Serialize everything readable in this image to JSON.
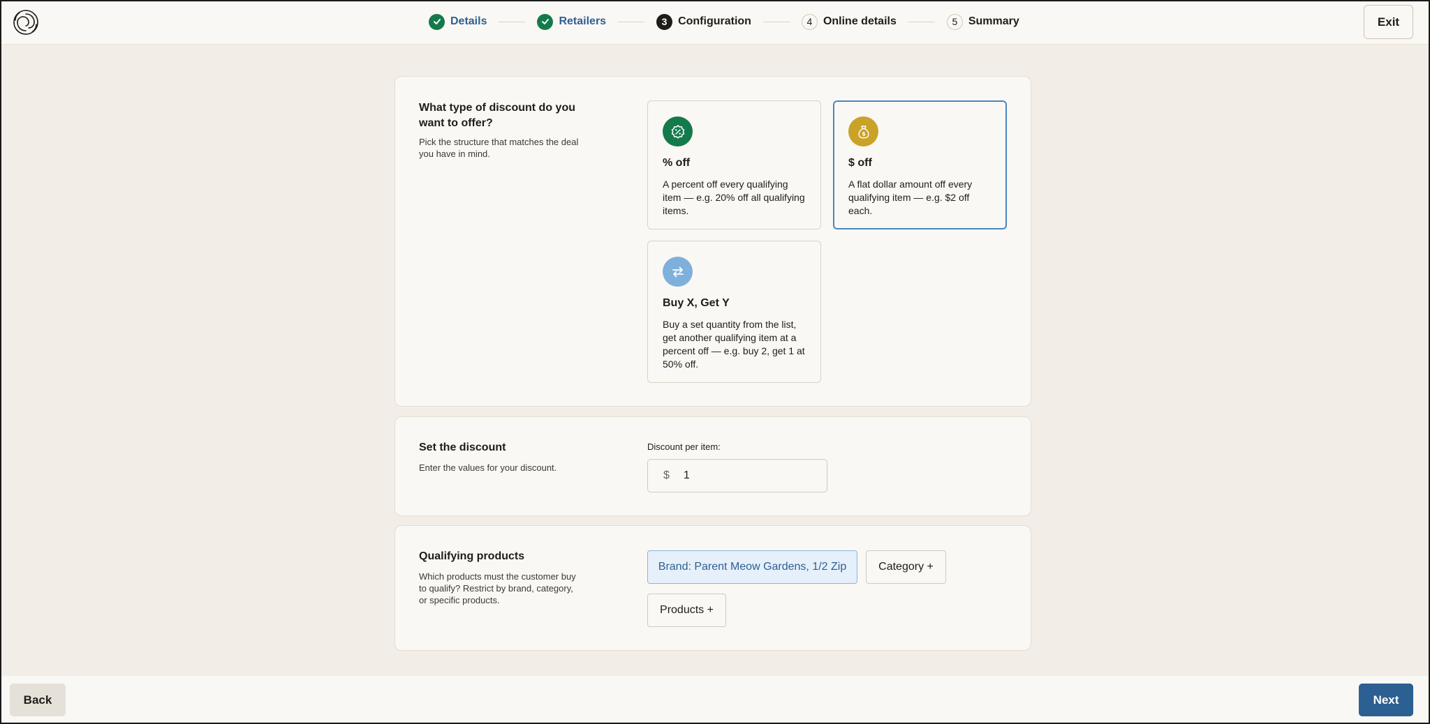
{
  "header": {
    "exit_label": "Exit",
    "steps": [
      {
        "number": "1",
        "label": "Details",
        "state": "done"
      },
      {
        "number": "2",
        "label": "Retailers",
        "state": "done"
      },
      {
        "number": "3",
        "label": "Configuration",
        "state": "current"
      },
      {
        "number": "4",
        "label": "Online details",
        "state": "todo"
      },
      {
        "number": "5",
        "label": "Summary",
        "state": "todo"
      }
    ]
  },
  "discount_type": {
    "title": "What type of discount do you want to offer?",
    "description": "Pick the structure that matches the deal you have in mind.",
    "options": [
      {
        "icon": "percent-badge-icon",
        "icon_color": "#147a4c",
        "title": "% off",
        "description": "A percent off every qualifying item — e.g. 20% off all qualifying items.",
        "selected": false
      },
      {
        "icon": "money-bag-icon",
        "icon_color": "#c9a227",
        "title": "$ off",
        "description": "A flat dollar amount off every qualifying item — e.g. $2 off each.",
        "selected": true
      },
      {
        "icon": "swap-arrows-icon",
        "icon_color": "#7fb0dc",
        "title": "Buy X, Get Y",
        "description": "Buy a set quantity from the list, get another qualifying item at a percent off — e.g. buy 2, get 1 at 50% off.",
        "selected": false
      }
    ]
  },
  "set_discount": {
    "title": "Set the discount",
    "description": "Enter the values for your discount.",
    "field_label": "Discount per item:",
    "prefix": "$",
    "value": "1"
  },
  "qualifying": {
    "title": "Qualifying products",
    "description": "Which products must the customer buy to qualify? Restrict by brand, category, or specific products.",
    "chips": [
      {
        "label": "Brand: Parent Meow Gardens, 1/2 Zip",
        "active": true
      },
      {
        "label": "Category +",
        "active": false
      },
      {
        "label": "Products +",
        "active": false
      }
    ]
  },
  "footer": {
    "back_label": "Back",
    "next_label": "Next"
  },
  "colors": {
    "accent_blue": "#2c5f92",
    "success_green": "#147a4c",
    "selected_border": "#4a86c0",
    "page_background": "#f2ede6"
  }
}
